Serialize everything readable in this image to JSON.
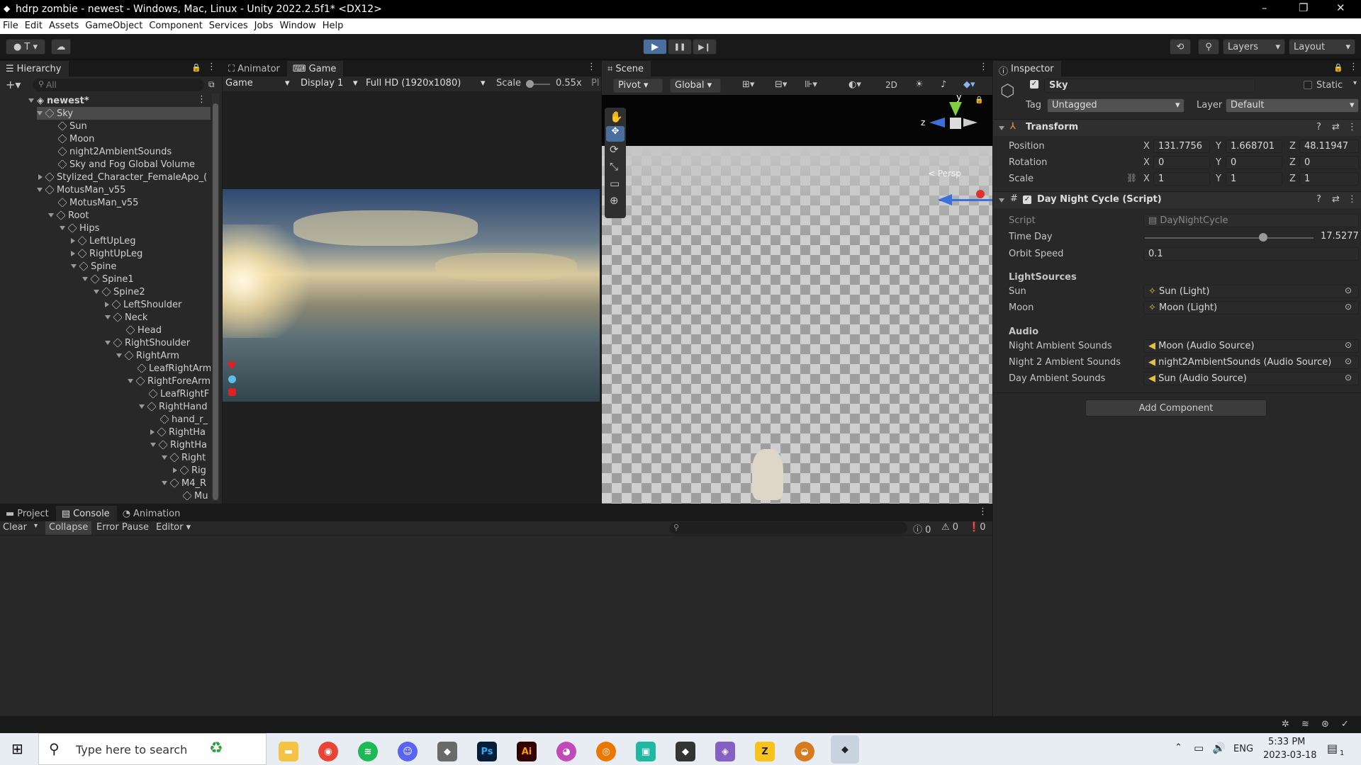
{
  "window": {
    "title": "hdrp zombie - newest - Windows, Mac, Linux - Unity 2022.2.5f1* <DX12>",
    "min": "–",
    "max": "❐",
    "close": "✕"
  },
  "menu": [
    "File",
    "Edit",
    "Assets",
    "GameObject",
    "Component",
    "Services",
    "Jobs",
    "Window",
    "Help"
  ],
  "toolbar": {
    "account": "T",
    "layers": "Layers",
    "layout": "Layout",
    "play": "▶",
    "pause": "❚❚",
    "step": "▶❙"
  },
  "hierarchy": {
    "tab": "Hierarchy",
    "search_placeholder": "All",
    "scene": "newest*",
    "rows": [
      "Sky",
      "Sun",
      "Moon",
      "night2AmbientSounds",
      "Sky and Fog Global Volume",
      "Stylized_Character_FemaleApo_(",
      "MotusMan_v55",
      "MotusMan_v55",
      "Root",
      "Hips",
      "LeftUpLeg",
      "RightUpLeg",
      "Spine",
      "Spine1",
      "Spine2",
      "LeftShoulder",
      "Neck",
      "Head",
      "RightShoulder",
      "RightArm",
      "LeafRightArm",
      "RightForeArm",
      "LeafRightF",
      "RightHand",
      "hand_r_",
      "RightHa",
      "RightHa",
      "Right",
      "Rig",
      "M4_R",
      "Mu"
    ]
  },
  "game": {
    "tabs": [
      "Animator",
      "Game"
    ],
    "mode": "Game",
    "display": "Display 1",
    "resolution": "Full HD (1920x1080)",
    "scale_label": "Scale",
    "scale_value": "0.55x",
    "play_focus": "Pl"
  },
  "scene": {
    "tab": "Scene",
    "pivot": "Pivot",
    "global": "Global",
    "btn2d": "2D",
    "persp": "< Persp",
    "axis_y": "y",
    "axis_z": "z"
  },
  "inspector": {
    "tab": "Inspector",
    "object_name": "Sky",
    "static": "Static",
    "tag_label": "Tag",
    "tag": "Untagged",
    "layer_label": "Layer",
    "layer": "Default",
    "transform": {
      "title": "Transform",
      "position_label": "Position",
      "rotation_label": "Rotation",
      "scale_label": "Scale",
      "position": [
        "131.7756",
        "1.668701",
        "48.11947"
      ],
      "rotation": [
        "0",
        "0",
        "0"
      ],
      "scale": [
        "1",
        "1",
        "1"
      ]
    },
    "script_comp": {
      "title": "Day Night Cycle (Script)",
      "script_label": "Script",
      "script": "DayNightCycle",
      "time_day_label": "Time Day",
      "time_day": "17.5277",
      "time_day_fraction": 0.7,
      "orbit_label": "Orbit Speed",
      "orbit": "0.1",
      "light_header": "LightSources",
      "sun_label": "Sun",
      "sun": "Sun (Light)",
      "moon_label": "Moon",
      "moon": "Moon (Light)",
      "audio_header": "Audio",
      "night_label": "Night Ambient Sounds",
      "night": "Moon (Audio Source)",
      "night2_label": "Night 2 Ambient Sounds",
      "night2": "night2AmbientSounds (Audio Source)",
      "day_label": "Day Ambient Sounds",
      "day": "Sun (Audio Source)"
    },
    "add_component": "Add Component"
  },
  "console": {
    "tabs": [
      "Project",
      "Console",
      "Animation"
    ],
    "clear": "Clear",
    "collapse": "Collapse",
    "error_pause": "Error Pause",
    "editor": "Editor",
    "count_log": "0",
    "count_warn": "0",
    "count_err": "0"
  },
  "taskbar": {
    "search_placeholder": "Type here to search",
    "lang": "ENG",
    "time": "5:33 PM",
    "date": "2023-03-18",
    "notif": "1"
  }
}
